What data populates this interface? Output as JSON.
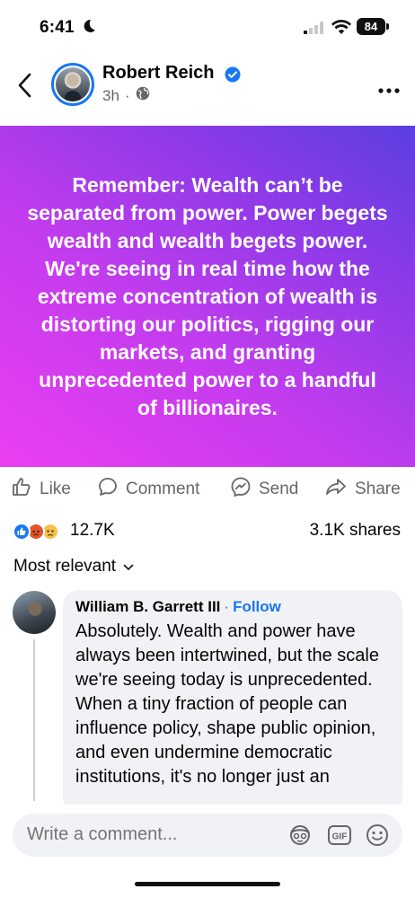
{
  "status_bar": {
    "time": "6:41",
    "battery": "84"
  },
  "post": {
    "author": "Robert Reich",
    "time": "3h",
    "text": "Remember: Wealth can’t be separated from power. Power begets wealth and wealth begets power. We're seeing in real time how the extreme concentration of wealth is distorting our politics, rigging our markets, and granting unprecedented power to a handful of billionaires.",
    "banner_colors": [
      "#ea3ef0",
      "#5b3fe0"
    ]
  },
  "actions": {
    "like": "Like",
    "comment": "Comment",
    "send": "Send",
    "share": "Share"
  },
  "stats": {
    "reactions": "12.7K",
    "shares": "3.1K shares",
    "reaction_icons": [
      "like-icon",
      "angry-icon",
      "sad-icon"
    ]
  },
  "sort": {
    "label": "Most relevant"
  },
  "comment": {
    "name": "William B. Garrett III",
    "separator": "·",
    "follow": "Follow",
    "text": "Absolutely. Wealth and power have always been intertwined, but the scale we're seeing today is unprecedented. When a tiny fraction of people can influence policy, shape public opinion, and even undermine democratic institutions, it's no longer just an"
  },
  "composer": {
    "placeholder": "Write a comment..."
  },
  "colors": {
    "accent": "#1877f2",
    "muted": "#65676b"
  }
}
